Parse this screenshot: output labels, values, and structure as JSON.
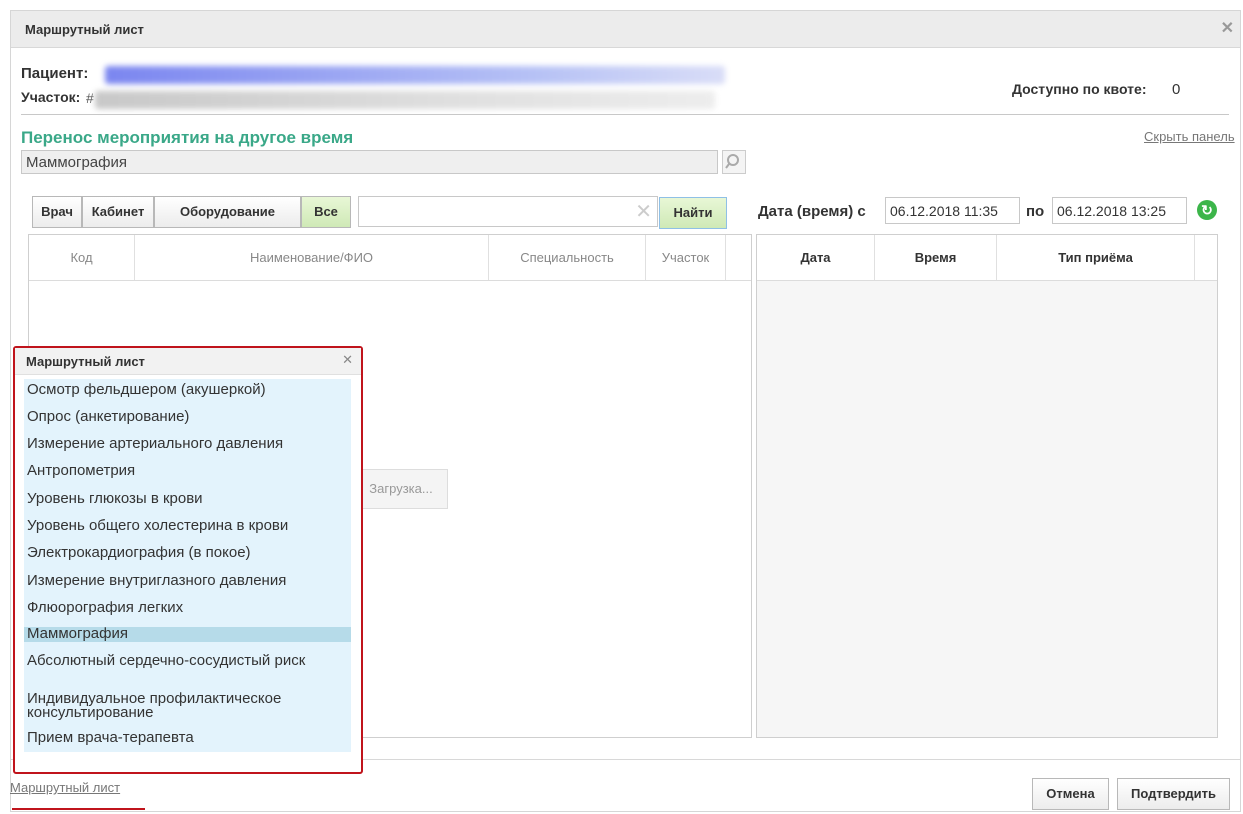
{
  "window": {
    "title": "Маршрутный лист"
  },
  "patient": {
    "label": "Пациент:",
    "district_label": "Участок:",
    "district_prefix": "#"
  },
  "quota": {
    "label": "Доступно по квоте:",
    "value": "0"
  },
  "section": {
    "title": "Перенос мероприятия на другое время",
    "hide_link": "Скрыть панель",
    "event_value": "Маммография"
  },
  "filter": {
    "tabs": [
      "Врач",
      "Кабинет",
      "Оборудование",
      "Все"
    ],
    "search_value": "",
    "find_label": "Найти",
    "date_label": "Дата (время) с",
    "date_from": "06.12.2018 11:35",
    "to_label": "по",
    "date_to": "06.12.2018 13:25"
  },
  "left_table": {
    "headers": [
      "Код",
      "Наименование/ФИО",
      "Специальность",
      "Участок"
    ],
    "loading": "Загрузка..."
  },
  "right_table": {
    "headers": [
      "Дата",
      "Время",
      "Тип приёма"
    ]
  },
  "popup": {
    "title": "Маршрутный лист",
    "items": [
      "Осмотр фельдшером (акушеркой)",
      "Опрос (анкетирование)",
      "Измерение артериального давления",
      "Антропометрия",
      "Уровень глюкозы в крови",
      "Уровень общего холестерина в крови",
      "Электрокардиография (в покое)",
      "Измерение внутриглазного давления",
      "Флюорография легких",
      "Маммография",
      "Абсолютный сердечно-сосудистый риск",
      "Индивидуальное профилактическое консультирование",
      "Прием врача-терапевта"
    ],
    "selected": "Маммография"
  },
  "footer": {
    "link": "Маршрутный лист",
    "cancel": "Отмена",
    "confirm": "Подтвердить"
  },
  "colors": {
    "accent_green": "#3aa888",
    "highlight_red": "#c0141c",
    "list_bg": "#e3f3fc",
    "selected_bg": "#b6dbe9"
  }
}
